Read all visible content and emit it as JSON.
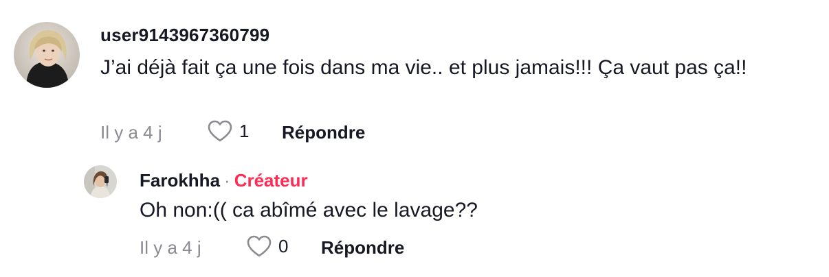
{
  "comments": [
    {
      "username": "user9143967360799",
      "text": "J’ai déjà fait ça une fois dans ma vie.. et plus jamais!!! Ça vaut pas ça!!",
      "time": "Il y a 4 j",
      "likes": "1",
      "reply_label": "Répondre",
      "like_icon": "heart-outline-icon"
    }
  ],
  "replies": [
    {
      "username": "Farokhha",
      "separator": "·",
      "badge": "Créateur",
      "text": "Oh non:(( ca abîmé avec le lavage??",
      "time": "Il y a 4 j",
      "likes": "0",
      "reply_label": "Répondre",
      "like_icon": "heart-outline-icon"
    }
  ],
  "colors": {
    "text": "#161823",
    "muted": "#8a8b91",
    "creator_badge": "#fe2c55"
  }
}
